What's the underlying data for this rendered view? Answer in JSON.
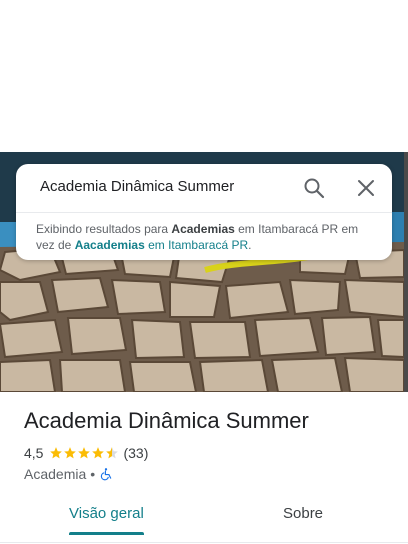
{
  "search": {
    "query": "Academia Dinâmica Summer"
  },
  "notice": {
    "prefix": "Exibindo resultados para ",
    "shown_term": "Academias",
    "shown_location": " em Itambaracá PR",
    "middle": " em vez de ",
    "original_term": "Aacademias",
    "original_location": " em Itambaracá PR",
    "suffix": "."
  },
  "place": {
    "name": "Academia Dinâmica Summer",
    "rating": "4,5",
    "stars_value": 4.5,
    "stars_max": 5,
    "review_count": "(33)",
    "category": "Academia",
    "separator": "•",
    "accessibility_icon": "wheelchair-icon"
  },
  "tabs": [
    {
      "label": "Visão geral",
      "active": true
    },
    {
      "label": "Sobre",
      "active": false
    }
  ],
  "colors": {
    "accent": "#137f8a",
    "star": "#fbbc04",
    "accessibility": "#1a73e8"
  }
}
